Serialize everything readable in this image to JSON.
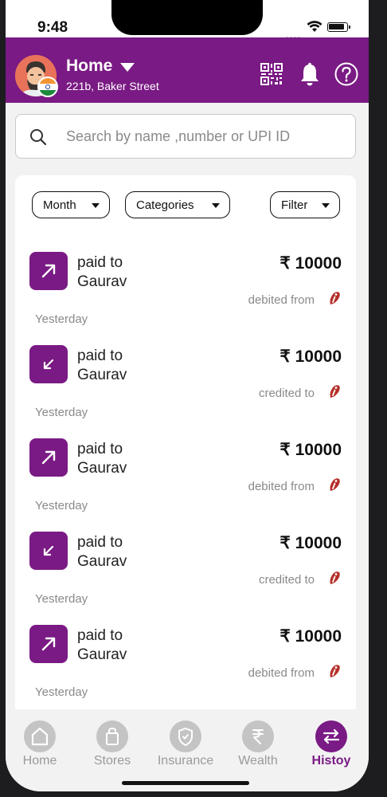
{
  "status_bar": {
    "time": "9:48"
  },
  "header": {
    "location_title": "Home",
    "address": "221b, Baker Street",
    "icons": [
      "qr-code-icon",
      "bell-icon",
      "help-icon"
    ]
  },
  "search": {
    "placeholder": "Search by name ,number or UPI ID"
  },
  "filters": {
    "month": "Month",
    "categories": "Categories",
    "filter": "Filter"
  },
  "transactions": [
    {
      "label_1": "paid to",
      "label_2": "Gaurav",
      "amount": "₹ 10000",
      "direction": "debited from",
      "date": "Yesterday",
      "type": "outgoing"
    },
    {
      "label_1": "paid to",
      "label_2": "Gaurav",
      "amount": "₹ 10000",
      "direction": "credited to",
      "date": "Yesterday",
      "type": "incoming"
    },
    {
      "label_1": "paid to",
      "label_2": "Gaurav",
      "amount": "₹ 10000",
      "direction": "debited from",
      "date": "Yesterday",
      "type": "outgoing"
    },
    {
      "label_1": "paid to",
      "label_2": "Gaurav",
      "amount": "₹ 10000",
      "direction": "credited to",
      "date": "Yesterday",
      "type": "incoming"
    },
    {
      "label_1": "paid to",
      "label_2": "Gaurav",
      "amount": "₹ 10000",
      "direction": "debited from",
      "date": "Yesterday",
      "type": "outgoing"
    }
  ],
  "tabs": [
    {
      "label": "Home",
      "icon": "home-icon",
      "active": false
    },
    {
      "label": "Stores",
      "icon": "bag-icon",
      "active": false
    },
    {
      "label": "Insurance",
      "icon": "shield-icon",
      "active": false
    },
    {
      "label": "Wealth",
      "icon": "rupee-icon",
      "active": false
    },
    {
      "label": "Histoy",
      "icon": "swap-icon",
      "active": true
    }
  ],
  "colors": {
    "brand": "#7a1a84",
    "background": "#f2f2f2",
    "muted_text": "#8a8a8a"
  }
}
